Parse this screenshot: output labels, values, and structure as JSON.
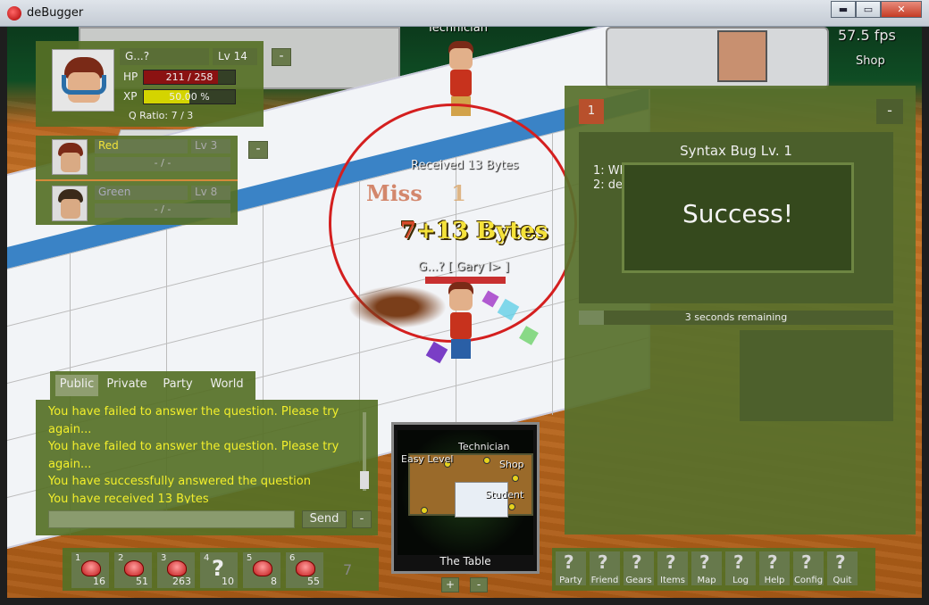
{
  "window": {
    "title": "deBugger",
    "min": "▬",
    "max": "▭",
    "close": "✕"
  },
  "hud": {
    "fps": "57.5 fps",
    "shop_label": "Shop"
  },
  "world": {
    "technician_label": "Technician",
    "received": "Received 13 Bytes",
    "miss": "Miss",
    "miss_digit": "1",
    "bytes_gain": "+13 Bytes",
    "bytes_digit": "7",
    "player_tag": "G...? [ Gary I> ]"
  },
  "player": {
    "name": "G...?",
    "level": "Lv 14",
    "hp_label": "HP",
    "hp_text": "211 / 258",
    "hp_fraction": 0.818,
    "xp_label": "XP",
    "xp_text": "50.00 %",
    "xp_fraction": 0.5,
    "q_ratio": "Q Ratio: 7 / 3",
    "collapse": "-"
  },
  "party": {
    "collapse": "-",
    "members": [
      {
        "name": "Red",
        "level": "Lv 3",
        "hp": "- / -",
        "name_color": "#f2e23a",
        "hair_color": "#7a2a17"
      },
      {
        "name": "Green",
        "level": "Lv 8",
        "hp": "- / -",
        "name_color": "#aab",
        "hair_color": "#3a2a1a"
      }
    ]
  },
  "question": {
    "number": "1",
    "collapse": "-",
    "title": "Syntax Bug Lv. 1",
    "option1": "1: Wh",
    "option1_tail": "...",
    "option2": "2: de",
    "option2_tail": "...",
    "result": "Success!",
    "timer_text": "3 seconds remaining",
    "timer_fraction": 0.08
  },
  "chat": {
    "tabs": [
      "Public",
      "Private",
      "Party",
      "World"
    ],
    "active_tab": "Public",
    "lines": [
      "You have failed to answer the question. Please try",
      "again...",
      "You have failed to answer the question. Please try",
      "again...",
      "You have successfully answered the question",
      "You have received 13 Bytes"
    ],
    "input_value": "",
    "send_label": "Send",
    "collapse": "-"
  },
  "hotbar": [
    {
      "num": "1",
      "count": "16",
      "icon": "bug-icon"
    },
    {
      "num": "2",
      "count": "51",
      "icon": "bug-icon"
    },
    {
      "num": "3",
      "count": "263",
      "icon": "bug-icon"
    },
    {
      "num": "4",
      "count": "10",
      "icon": "question-icon"
    },
    {
      "num": "5",
      "count": "8",
      "icon": "bug-icon"
    },
    {
      "num": "6",
      "count": "55",
      "icon": "bug-icon"
    },
    {
      "num": "7",
      "count": "",
      "icon": "empty"
    }
  ],
  "minimap": {
    "name": "The Table",
    "labels": [
      "Technician",
      "Easy Level",
      "Shop",
      "Student"
    ],
    "zoom_in": "+",
    "zoom_out": "-"
  },
  "menu": {
    "items": [
      {
        "label": "Party",
        "icon": "?"
      },
      {
        "label": "Friend",
        "icon": "?"
      },
      {
        "label": "Gears",
        "icon": "?"
      },
      {
        "label": "Items",
        "icon": "?"
      },
      {
        "label": "Map",
        "icon": "?"
      },
      {
        "label": "Log",
        "icon": "?"
      },
      {
        "label": "Help",
        "icon": "?"
      },
      {
        "label": "Config",
        "icon": "?"
      },
      {
        "label": "Quit",
        "icon": "?"
      }
    ]
  },
  "colors": {
    "panel": "#587026",
    "hp_bar": "#8b1212",
    "xp_bar": "#d4d400",
    "chat_text": "#f3ef2b",
    "accent": "#b8502c"
  }
}
